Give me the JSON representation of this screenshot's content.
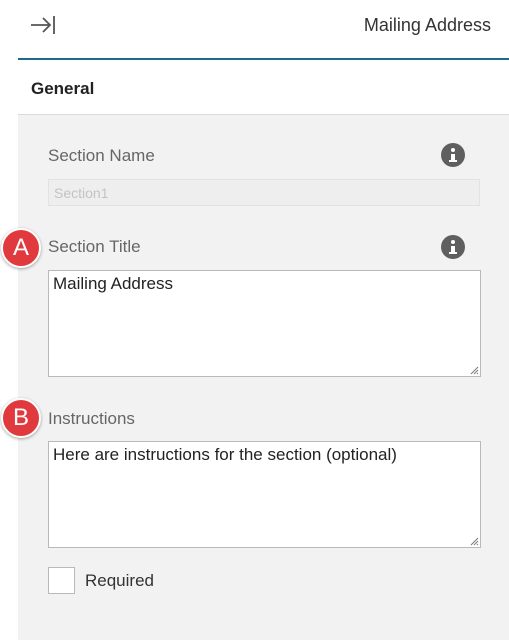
{
  "header": {
    "collapse_icon": "collapse-right-arrow-icon",
    "title": "Mailing Address"
  },
  "section": {
    "label": "General"
  },
  "fields": {
    "section_name": {
      "label": "Section Name",
      "value": "Section1",
      "info_icon": "info-icon"
    },
    "section_title": {
      "label": "Section Title",
      "value": "Mailing Address",
      "info_icon": "info-icon"
    },
    "instructions": {
      "label": "Instructions",
      "value": "Here are instructions for the section (optional)"
    },
    "required": {
      "label": "Required",
      "checked": false
    }
  },
  "markers": {
    "a": "A",
    "b": "B"
  },
  "colors": {
    "accent_rule": "#1e6a8d",
    "marker": "#e03a3e",
    "body_bg": "#f2f2f2"
  }
}
